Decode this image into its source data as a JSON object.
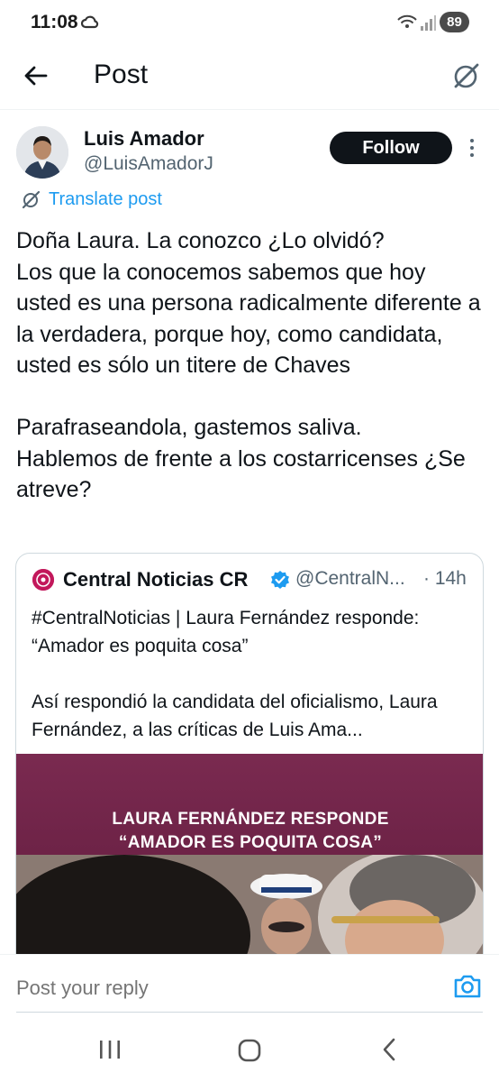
{
  "status_bar": {
    "time": "11:08",
    "battery": "89",
    "icons": [
      "cloud-icon",
      "wifi-icon",
      "signal-icon"
    ]
  },
  "header": {
    "title": "Post",
    "back_icon": "arrow-left-icon",
    "right_icon": "grok-icon"
  },
  "post": {
    "author_name": "Luis Amador",
    "author_handle": "@LuisAmadorJ",
    "follow_label": "Follow",
    "translate_label": "Translate post",
    "text": "Doña Laura. La conozco ¿Lo olvidó?\nLos que la conocemos sabemos que hoy usted es una persona radicalmente diferente a la verdadera, porque hoy, como candidata, usted es sólo un titere de Chaves\n\nParafraseandola, gastemos saliva.\nHablemos de frente a los costarricenses ¿Se atreve?"
  },
  "quote": {
    "name": "Central Noticias CR",
    "handle": "@CentralN...",
    "time": "· 14h",
    "verified_color": "#1d9bf0",
    "text": "#CentralNoticias | Laura Fernández responde: “Amador es poquita cosa”\n\nAsí respondió la candidata del oficialismo, Laura Fernández, a las críticas de Luis Ama...",
    "media_caption_line1": "LAURA FERNÁNDEZ RESPONDE",
    "media_caption_line2": "“AMADOR ES POQUITA COSA”"
  },
  "reply": {
    "placeholder": "Post your reply",
    "camera_icon": "camera-icon"
  },
  "colors": {
    "accent": "#1d9bf0",
    "text": "#0f1419",
    "secondary": "#536471",
    "media_bg": "#6e2347"
  }
}
